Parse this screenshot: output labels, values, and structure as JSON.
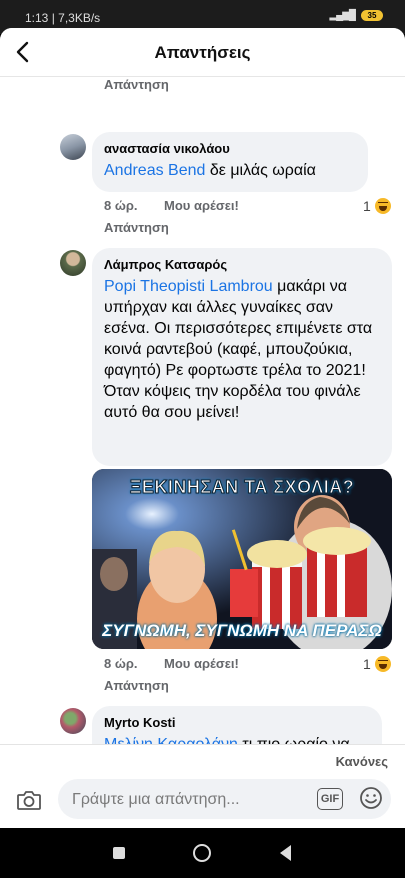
{
  "status": {
    "time_speed": "1:13 | 7,3KB/s",
    "battery": "35"
  },
  "header": {
    "title": "Απαντήσεις"
  },
  "top_reply_label": "Απάντηση",
  "comments": [
    {
      "author": "αναστασία νικολάου",
      "mention": "Andreas Bend",
      "text": " δε μιλάς ωραία",
      "time": "8 ώρ.",
      "like": "Μου αρέσει!",
      "reply": "Απάντηση",
      "reaction_count": "1"
    },
    {
      "author": "Λάμπρος Κατσαρός",
      "mention": "Popi Theopisti Lambrou",
      "text": " μακάρι να υπήρχαν και άλλες γυναίκες σαν εσένα. Οι περισσότερες επιμένετε στα κοινά ραντεβού (καφέ, μπουζούκια, φαγητό) Ρε φορτωστε τρέλα το 2021! Όταν κόψεις την κορδέλα του φινάλε αυτό θα σου μείνει!",
      "meme_top": "ΞΕΚΙΝΗΣΑΝ ΤΑ ΣΧΟΛΙΑ?",
      "meme_bottom": "ΣΥΓΝΩΜΗ, ΣΥΓΝΩΜΗ ΝΑ ΠΕΡΑΣΩ",
      "time": "8 ώρ.",
      "like": "Μου αρέσει!",
      "reply": "Απάντηση",
      "reaction_count": "1"
    },
    {
      "author": "Myrto Kosti",
      "mention": "Μελίνη Καραολάνη",
      "text": " τι πιο ωραίο να σε δει ο άλλος καταϊδρωμενη"
    }
  ],
  "composer": {
    "cancel": "Κανόνες",
    "placeholder": "Γράψτε μια απάντηση...",
    "gif": "GIF"
  },
  "icons": {
    "back": "back-arrow-icon",
    "camera": "camera-icon",
    "emoji": "emoji-icon",
    "haha": "haha-reaction-icon"
  }
}
